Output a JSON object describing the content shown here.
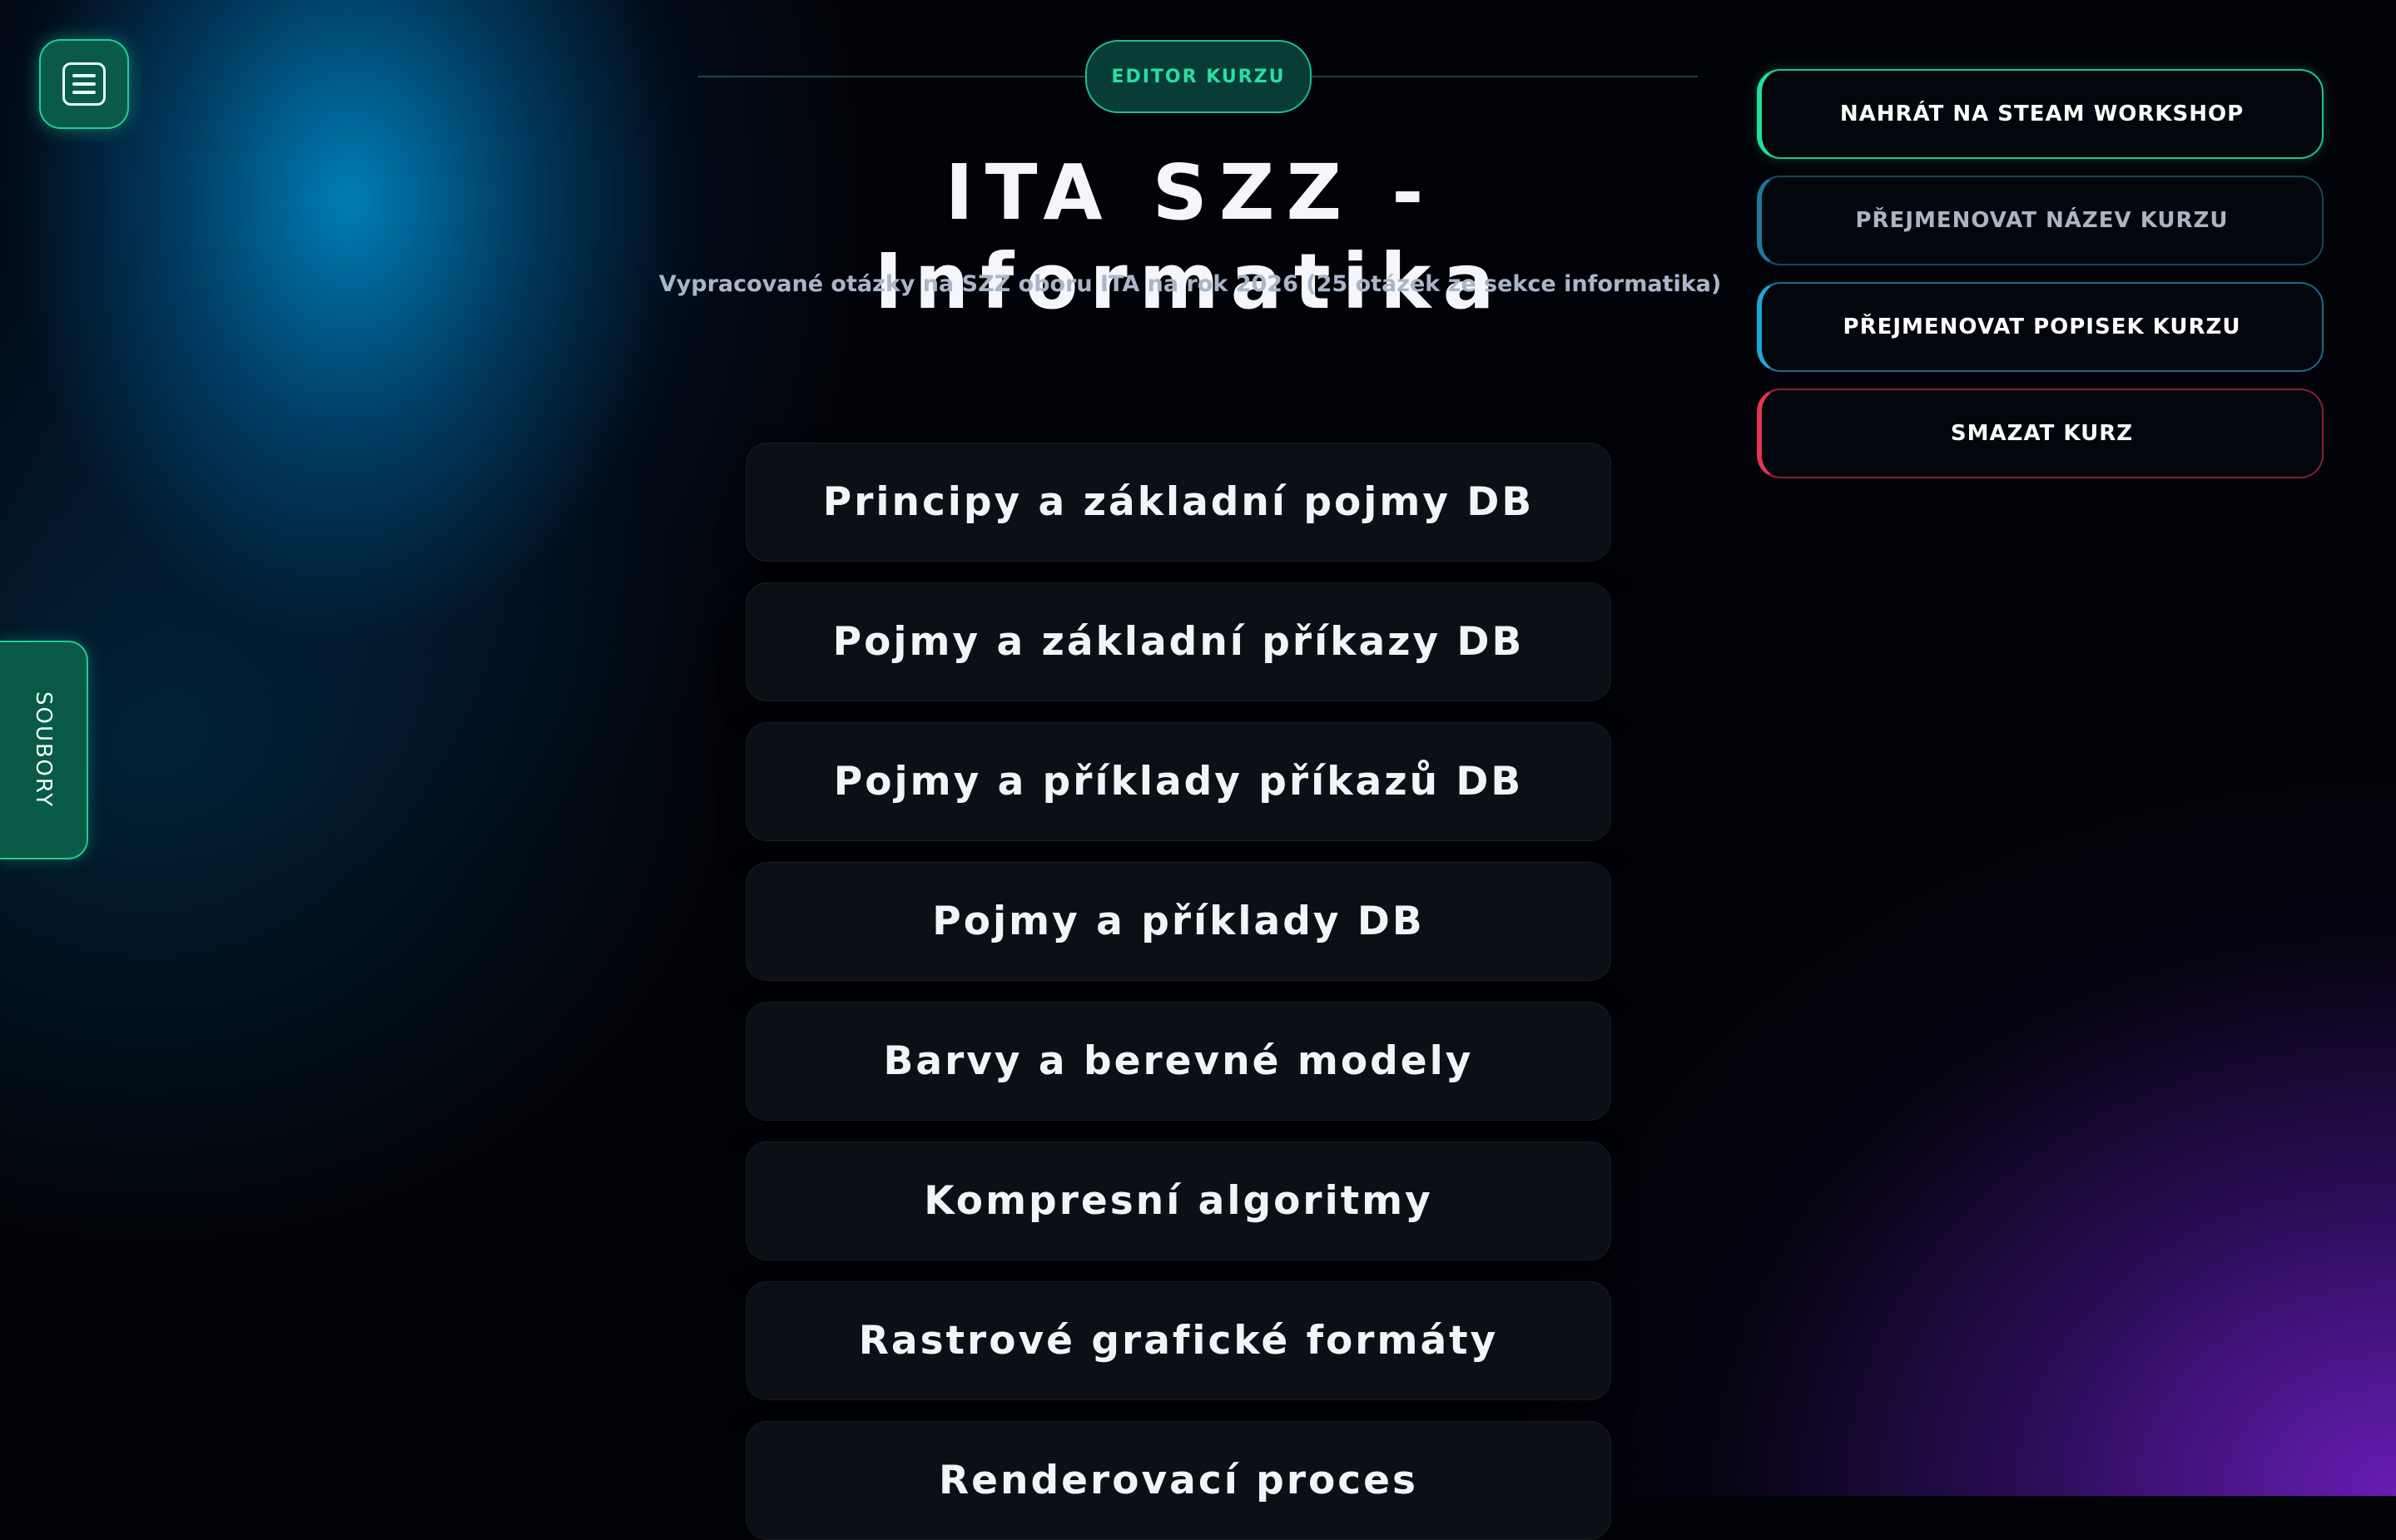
{
  "header": {
    "badge": "EDITOR KURZU",
    "title": "ITA SZZ - Informatika",
    "subtitle": "Vypracované otázky na SZZ oboru ITA na rok 2026 (25 otázek ze sekce informatika)"
  },
  "sidebar": {
    "tab_label": "SOUBORY"
  },
  "lessons": [
    "Principy a základní pojmy DB",
    "Pojmy a základní příkazy DB",
    "Pojmy a příklady příkazů DB",
    "Pojmy a příklady DB",
    "Barvy a berevné modely",
    "Kompresní algoritmy",
    "Rastrové grafické formáty",
    "Renderovací proces"
  ],
  "actions": {
    "upload": "NAHRÁT NA STEAM WORKSHOP",
    "rename_title": "PŘEJMENOVAT NÁZEV KURZU",
    "rename_desc": "PŘEJMENOVAT POPISEK KURZU",
    "delete": "SMAZAT KURZ"
  },
  "colors": {
    "accent_green": "#1fcf93",
    "accent_teal": "#1ea6d6",
    "danger_red": "#e23550",
    "background": "#020308"
  }
}
